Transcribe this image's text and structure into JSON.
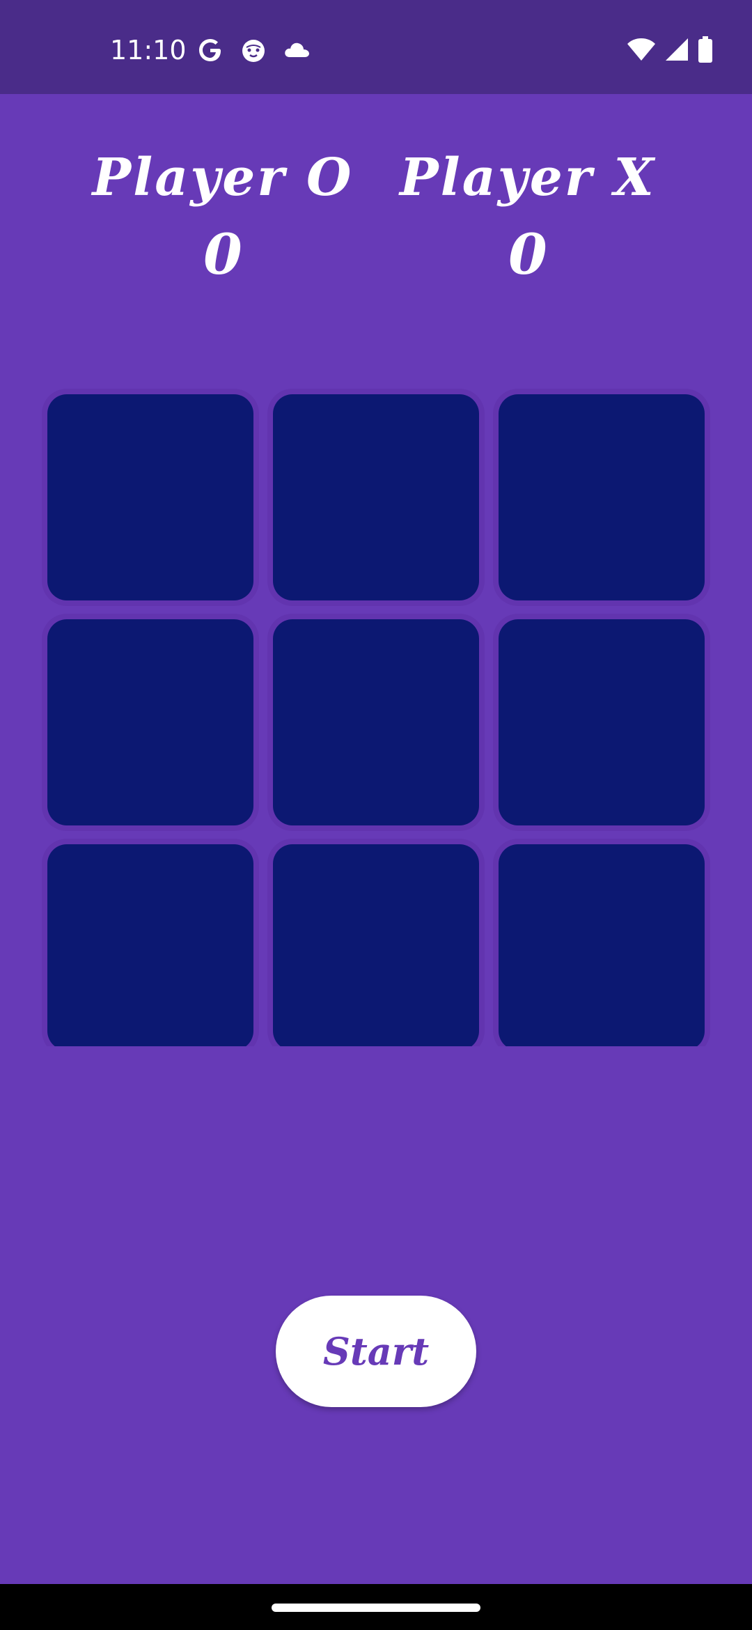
{
  "status_bar": {
    "time": "11:10",
    "left_icons": [
      "google-icon",
      "cat-face-icon",
      "cloud-icon"
    ],
    "right_icons": [
      "wifi-icon",
      "cell-signal-icon",
      "battery-icon"
    ]
  },
  "scoreboard": {
    "player_o": {
      "label": "Player O",
      "score": "0"
    },
    "player_x": {
      "label": "Player X",
      "score": "0"
    }
  },
  "board": {
    "cells": [
      "",
      "",
      "",
      "",
      "",
      "",
      "",
      "",
      ""
    ]
  },
  "start_button": {
    "label": "Start"
  },
  "colors": {
    "background": "#673AB7",
    "status_bar": "#4A2C89",
    "cell": "#0C1872",
    "button_text": "#673AB7",
    "nav_bar": "#000000"
  }
}
